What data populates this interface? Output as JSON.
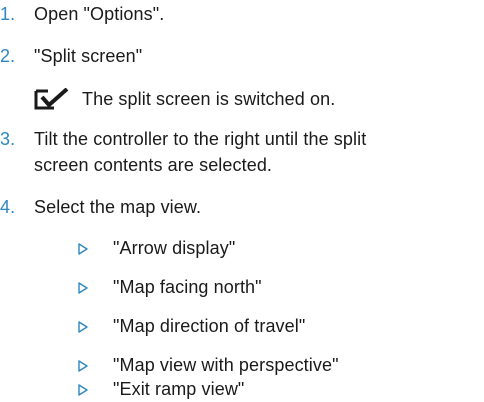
{
  "steps": [
    {
      "number": "1.",
      "text": "Open \"Options\"."
    },
    {
      "number": "2.",
      "text": "\"Split screen\""
    },
    {
      "number": "3.",
      "text_line1": "Tilt the controller to the right until the split",
      "text_line2": "screen contents are selected."
    },
    {
      "number": "4.",
      "text": "Select the map view."
    }
  ],
  "result": {
    "icon": "check-result-icon",
    "text": "The split screen is switched on."
  },
  "map_views": [
    "\"Arrow display\"",
    "\"Map facing north\"",
    "\"Map direction of travel\"",
    "\"Map view with perspective\"",
    "\"Exit ramp view\""
  ],
  "colors": {
    "step_number": "#2e86c1",
    "text": "#1a1a1a",
    "arrow": "#2e86c1"
  }
}
